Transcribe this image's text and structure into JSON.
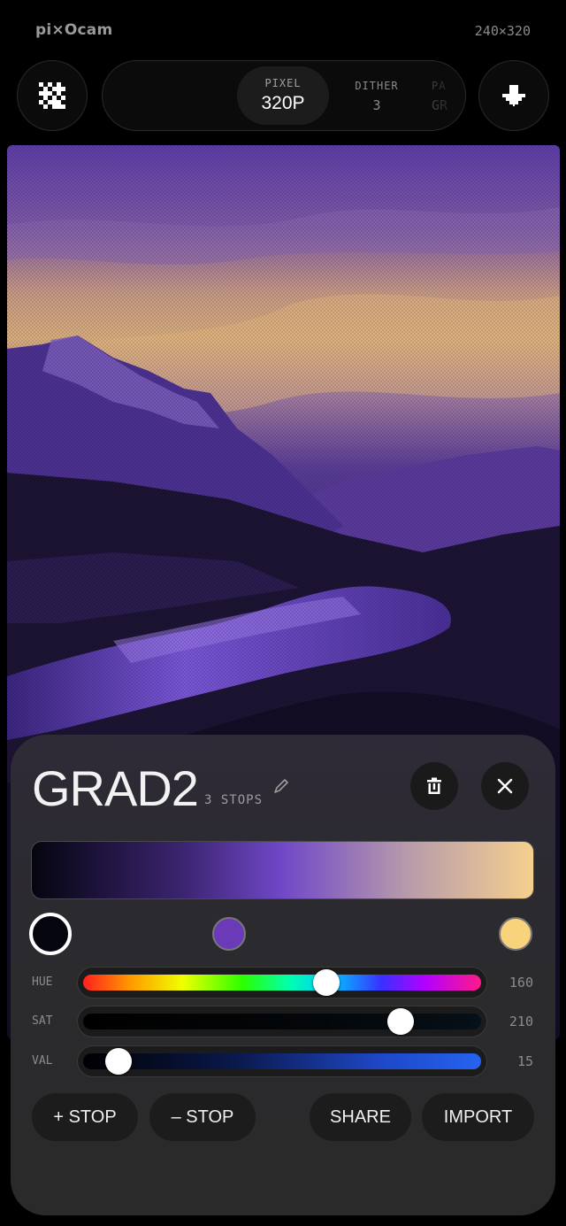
{
  "header": {
    "app_title": "pi⨯Ocam",
    "resolution": "240×320"
  },
  "toolbar": {
    "left_icon": "checker-pixel-icon",
    "right_icon": "download-arrow-icon",
    "modes": [
      {
        "label": "PIXEL",
        "value": "320P",
        "active": true
      },
      {
        "label": "DITHER",
        "value": "3",
        "active": false
      },
      {
        "label": "PA",
        "value": "GR",
        "active": false
      }
    ]
  },
  "gradient_editor": {
    "name": "GRAD2",
    "stops_count": "3 STOPS",
    "stops": [
      {
        "color": "#050510",
        "selected": true
      },
      {
        "color": "#6a3ab8",
        "selected": false
      },
      {
        "color": "#f9d27c",
        "selected": false
      }
    ],
    "sliders": [
      {
        "label": "HUE",
        "value": "160",
        "fraction": 0.62
      },
      {
        "label": "SAT",
        "value": "210",
        "fraction": 0.82
      },
      {
        "label": "VAL",
        "value": "15",
        "fraction": 0.06
      }
    ],
    "buttons": {
      "add_stop": "+ STOP",
      "remove_stop": "– STOP",
      "share": "SHARE",
      "import": "IMPORT"
    }
  },
  "colors": {
    "background": "#000000",
    "sheet": "#2b2a2e",
    "accent_purple": "#6a3ab8",
    "accent_gold": "#f9d27c"
  }
}
